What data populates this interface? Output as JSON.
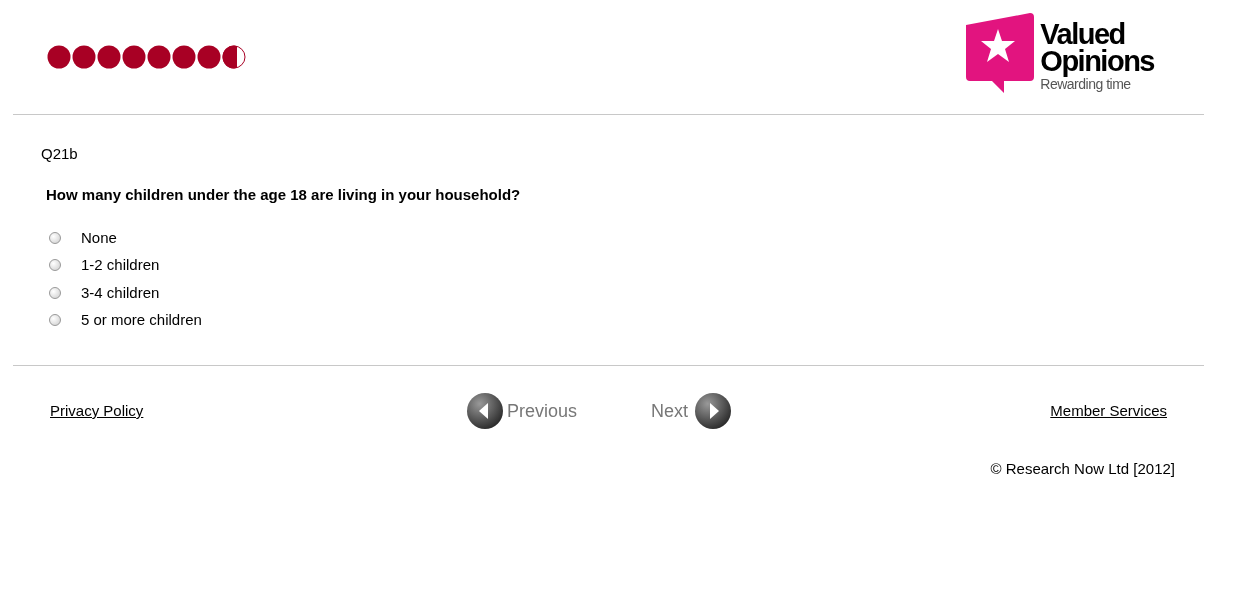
{
  "progress_dots": [
    {
      "kind": "full"
    },
    {
      "kind": "full"
    },
    {
      "kind": "full"
    },
    {
      "kind": "full"
    },
    {
      "kind": "full"
    },
    {
      "kind": "full"
    },
    {
      "kind": "full"
    },
    {
      "kind": "half"
    }
  ],
  "logo": {
    "name_line_1": "Valued",
    "name_line_2": "Opinions",
    "tagline": "Rewarding time"
  },
  "question": {
    "code": "Q21b",
    "text": "How many children under the age 18 are living in your household?",
    "options": [
      {
        "label": "None",
        "selected": false
      },
      {
        "label": "1-2 children",
        "selected": false
      },
      {
        "label": "3-4 children",
        "selected": false
      },
      {
        "label": "5 or more children",
        "selected": false
      }
    ]
  },
  "footer": {
    "privacy_link": "Privacy Policy",
    "previous_button": "Previous",
    "next_button": "Next",
    "member_link": "Member Services",
    "copyright": "© Research Now Ltd [2012]"
  }
}
